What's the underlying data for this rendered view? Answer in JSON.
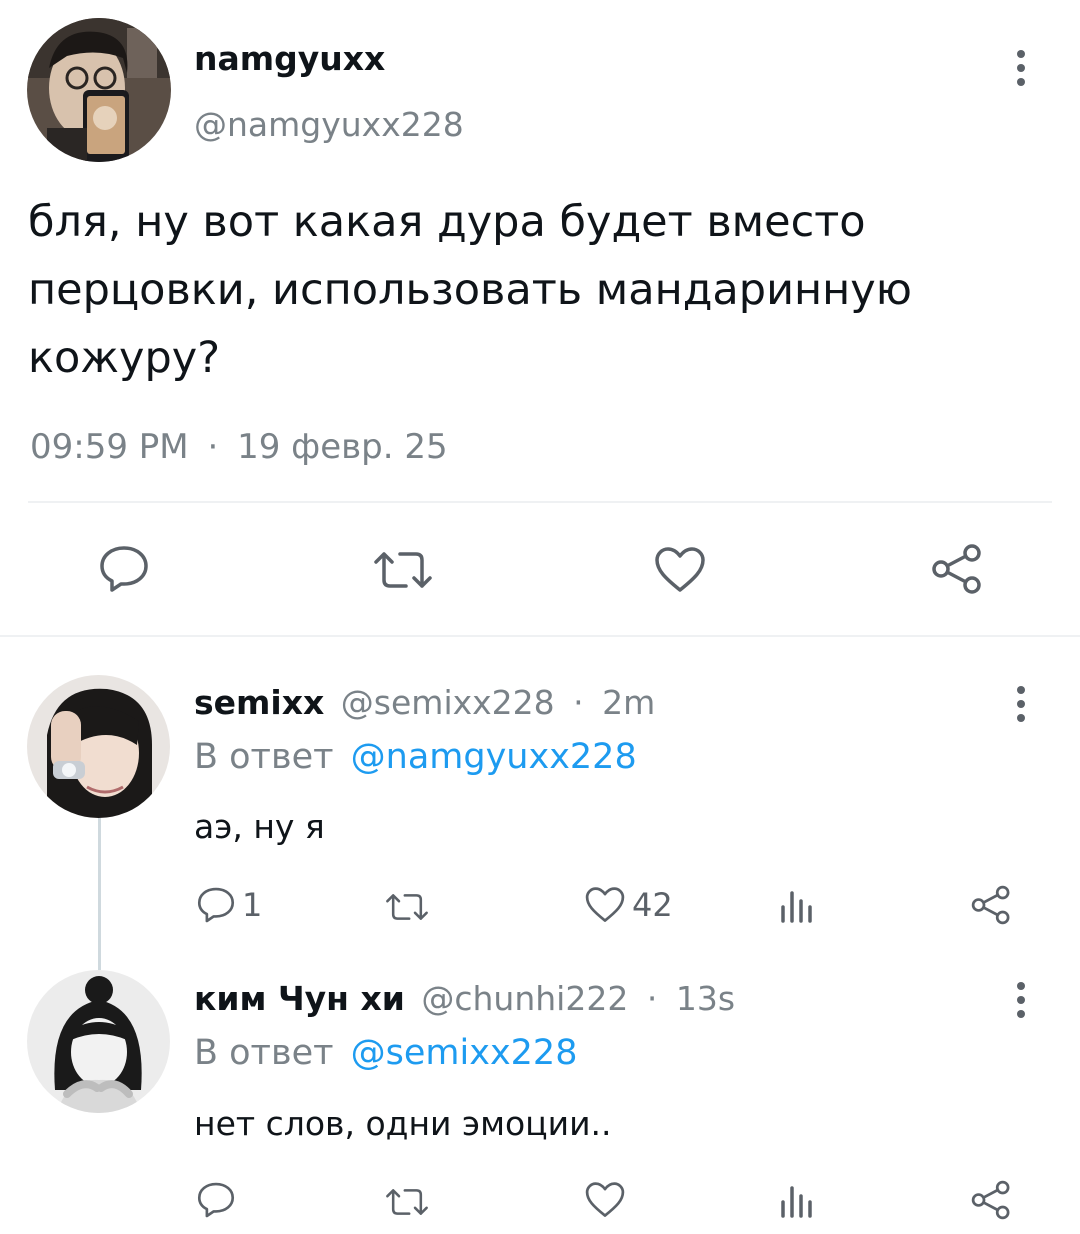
{
  "main_tweet": {
    "display_name": "namgyuxx",
    "handle": "@namgyuxx228",
    "text_lines": [
      "бля, ну вот какая дура будет вместо",
      "перцовки, использовать мандаринную",
      "кожуру?"
    ],
    "time": "09:59 PM",
    "separator": "·",
    "date": "19 февр. 25"
  },
  "replies": [
    {
      "display_name": "semixx",
      "handle": "@semixx228",
      "separator": "·",
      "age": "2m",
      "reply_prefix": "В ответ",
      "reply_to": "@namgyuxx228",
      "text": "аэ, ну я",
      "reply_count": "1",
      "like_count": "42"
    },
    {
      "display_name": "ким Чун хи",
      "handle": "@chunhi222",
      "separator": "·",
      "age": "13s",
      "reply_prefix": "В ответ",
      "reply_to": "@semixx228",
      "text": "нет слов, одни эмоции.."
    }
  ],
  "icons": {
    "reply": "speech-bubble-icon",
    "retweet": "retweet-arrows-icon",
    "like": "heart-icon",
    "stats": "bar-chart-icon",
    "share": "share-nodes-icon",
    "more": "vertical-dots-icon"
  },
  "colors": {
    "link": "#1d9bf0",
    "secondary_text": "#7a8288",
    "icon": "#5b6168",
    "divider": "#eff1f3"
  }
}
